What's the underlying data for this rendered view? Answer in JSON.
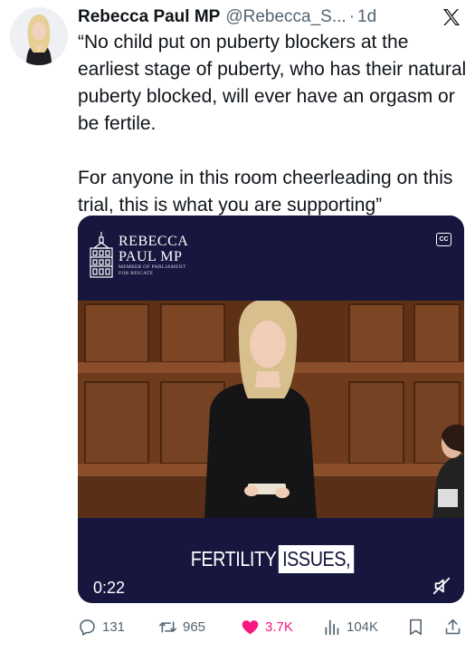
{
  "author": {
    "name": "Rebecca Paul MP",
    "handle": "@Rebecca_S...",
    "separator": "·",
    "time": "1d"
  },
  "tweet": {
    "paragraph1": "“No child put on puberty blockers at the earliest stage of puberty, who has their natural puberty blocked, will ever have an orgasm or be fertile.",
    "paragraph2": "For anyone in this room cheerleading on this trial, this is what you are supporting”"
  },
  "video": {
    "logo_title_line1": "REBECCA",
    "logo_title_line2": "PAUL MP",
    "logo_sub_line1": "MEMBER OF PARLIAMENT",
    "logo_sub_line2": "FOR REIGATE",
    "cc_label": "CC",
    "caption_word1": "FERTILITY",
    "caption_word2": "ISSUES,",
    "duration": "0:22",
    "muted": true
  },
  "actions": {
    "replies": "131",
    "reposts": "965",
    "likes": "3.7K",
    "views": "104K",
    "liked": true
  },
  "icons": {
    "brand": "x-logo-icon",
    "reply": "reply-icon",
    "repost": "repost-icon",
    "like": "heart-icon",
    "views": "views-icon",
    "bookmark": "bookmark-icon",
    "share": "share-icon",
    "mute": "mute-icon",
    "captions": "captions-icon"
  },
  "colors": {
    "like": "#f91880",
    "secondary_text": "#536471",
    "video_frame": "#16163f"
  }
}
